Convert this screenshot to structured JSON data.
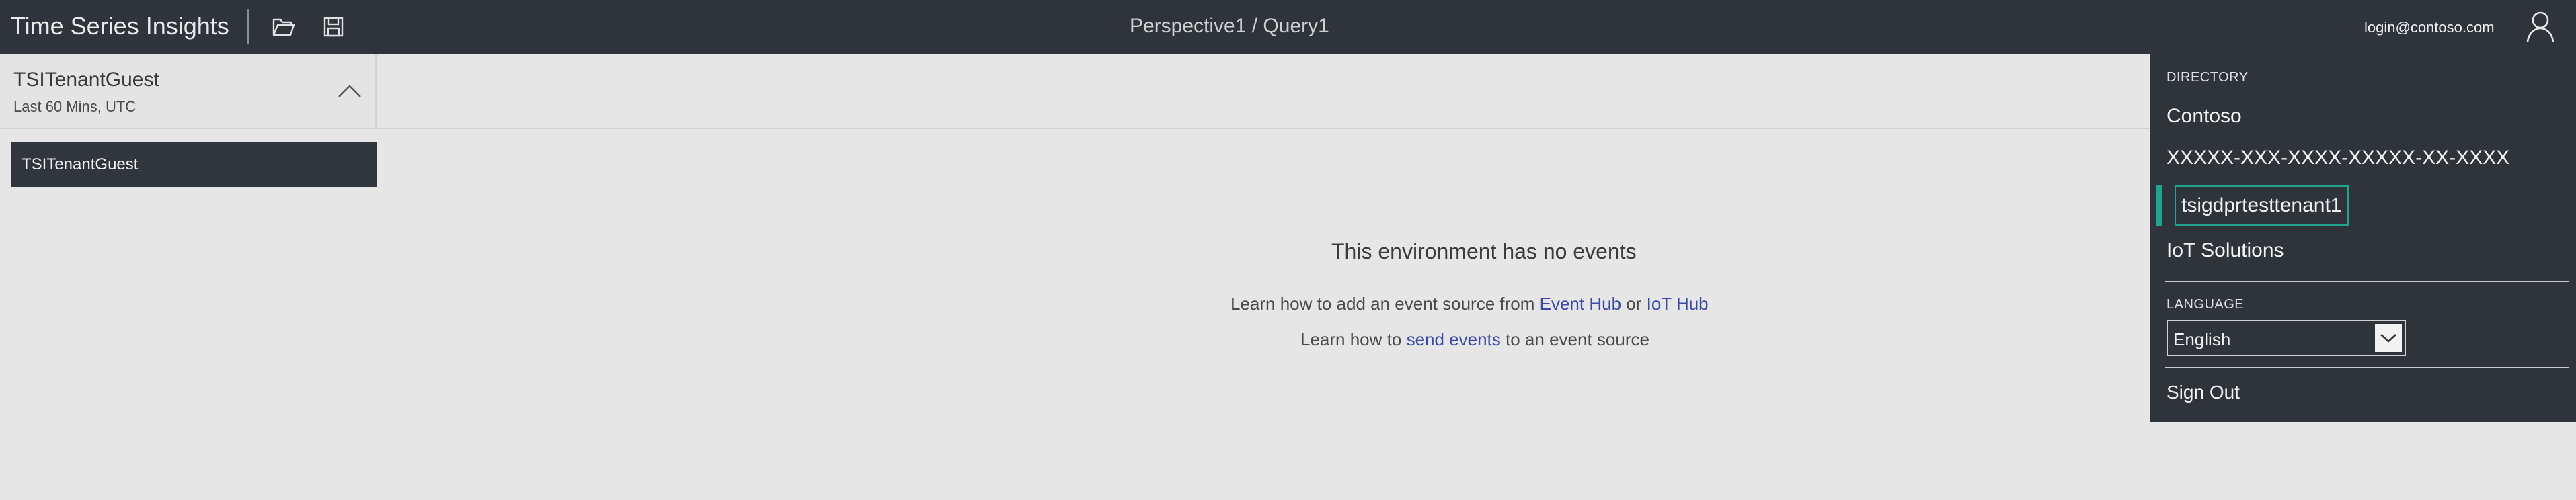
{
  "header": {
    "app_title": "Time Series Insights",
    "open_icon": "folder-open-icon",
    "save_icon": "save-icon",
    "breadcrumb": "Perspective1 / Query1",
    "user_email": "login@contoso.com",
    "user_icon": "user-icon",
    "background": "#2f333a"
  },
  "environment": {
    "name": "TSITenantGuest",
    "time_range": "Last 60 Mins, UTC",
    "list": [
      "TSITenantGuest"
    ]
  },
  "empty_state": {
    "title": "This environment has no events",
    "line1_prefix": "Learn how to add an event source from",
    "line1_link1": "Event Hub",
    "line1_middle": "or",
    "line1_link2": "IoT Hub",
    "line2_prefix": "Learn how to",
    "line2_link": "send events",
    "line2_suffix": "to an event source",
    "link_color": "#3b4aa8"
  },
  "menu": {
    "directory_label": "DIRECTORY",
    "directories": [
      "Contoso",
      "XXXXX-XXX-XXXX-XXXXX-XX-XXXX",
      "tsigdprtesttenant1",
      "IoT Solutions"
    ],
    "selected_directory": "tsigdprtesttenant1",
    "accent_color": "#1da58e",
    "language_label": "LANGUAGE",
    "language_value": "English",
    "sign_out": "Sign Out"
  }
}
